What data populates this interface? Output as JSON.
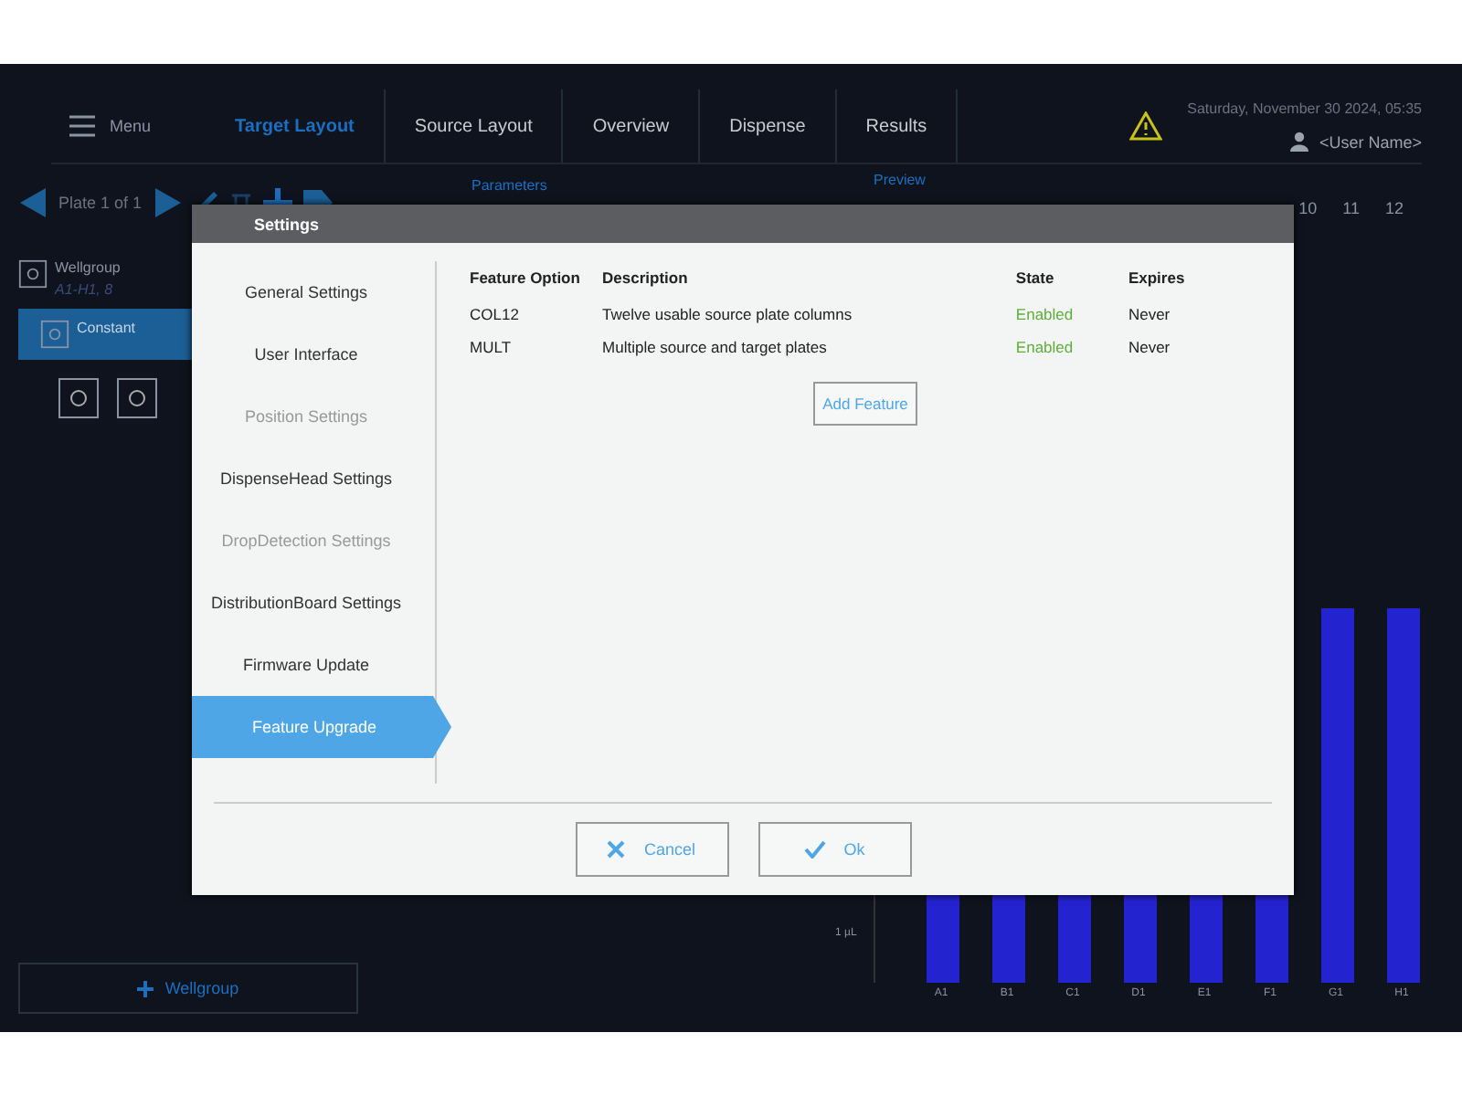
{
  "header": {
    "menu": "Menu",
    "tabs": [
      {
        "label": "Target Layout",
        "selected": true
      },
      {
        "label": "Source Layout",
        "selected": false
      },
      {
        "label": "Overview",
        "selected": false
      },
      {
        "label": "Dispense",
        "selected": false
      },
      {
        "label": "Results",
        "selected": false
      }
    ],
    "datetime": "Saturday, November 30 2024, 05:35",
    "user": "<User Name>"
  },
  "plate_toolbar": {
    "label": "Plate 1 of 1"
  },
  "tree": [
    {
      "label": "Wellgroup",
      "detail": "A1-H1, 8",
      "selected": false
    },
    {
      "label": "Constant",
      "selected": true
    }
  ],
  "add_wellgroup": "Wellgroup",
  "parameters": {
    "title": "Parameters"
  },
  "preview": {
    "title": "Preview",
    "columns": [
      "10",
      "11",
      "12"
    ],
    "y_tick": "1 µL",
    "bar_labels": [
      "A1",
      "B1",
      "C1",
      "D1",
      "E1",
      "F1",
      "G1",
      "H1"
    ]
  },
  "dialog": {
    "title": "Settings",
    "nav": [
      {
        "label": "General Settings",
        "disabled": false,
        "selected": false
      },
      {
        "label": "User Interface",
        "disabled": false,
        "selected": false
      },
      {
        "label": "Position Settings",
        "disabled": true,
        "selected": false
      },
      {
        "label": "DispenseHead Settings",
        "disabled": false,
        "selected": false
      },
      {
        "label": "DropDetection Settings",
        "disabled": true,
        "selected": false
      },
      {
        "label": "DistributionBoard Settings",
        "disabled": false,
        "selected": false
      },
      {
        "label": "Firmware Update",
        "disabled": false,
        "selected": false
      },
      {
        "label": "Feature Upgrade",
        "disabled": false,
        "selected": true
      }
    ],
    "columns": [
      "Feature Option",
      "Description",
      "State",
      "Expires"
    ],
    "rows": [
      {
        "option": "COL12",
        "description": "Twelve usable source plate columns",
        "state": "Enabled",
        "enabled": true,
        "expires": "Never"
      },
      {
        "option": "MULT",
        "description": "Multiple source and target plates",
        "state": "Enabled",
        "enabled": true,
        "expires": "Never"
      }
    ],
    "add_button": "Add Feature",
    "buttons": [
      {
        "kind": "cancel",
        "label": "Cancel"
      },
      {
        "kind": "ok",
        "label": "Ok"
      }
    ]
  }
}
